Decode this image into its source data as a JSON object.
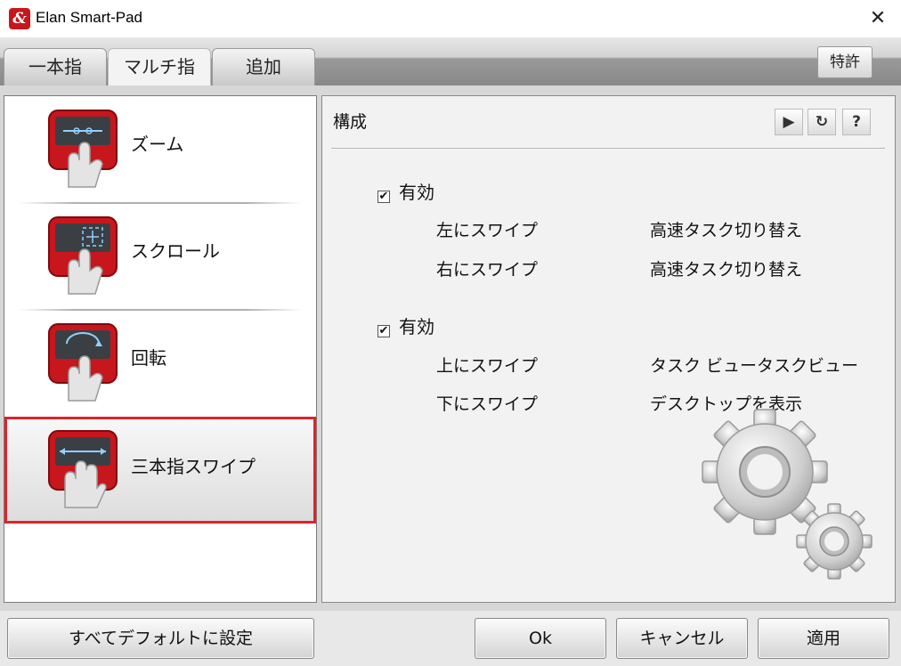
{
  "window": {
    "title": "Elan Smart-Pad",
    "app_icon": "elan-logo-icon",
    "close_glyph": "✕"
  },
  "tabs": [
    {
      "label": "一本指",
      "active": false
    },
    {
      "label": "マルチ指",
      "active": true
    },
    {
      "label": "追加",
      "active": false
    }
  ],
  "patent_button": "特許",
  "gestures": [
    {
      "label": "ズーム",
      "icon": "zoom-gesture-icon",
      "selected": false
    },
    {
      "label": "スクロール",
      "icon": "scroll-gesture-icon",
      "selected": false
    },
    {
      "label": "回転",
      "icon": "rotate-gesture-icon",
      "selected": false
    },
    {
      "label": "三本指スワイプ",
      "icon": "three-finger-swipe-icon",
      "selected": true
    }
  ],
  "config": {
    "title": "構成",
    "toolbar": {
      "play": "▶",
      "refresh": "↻",
      "help": "?"
    },
    "groups": [
      {
        "enabled_label": "有効",
        "checked": true,
        "rows": [
          {
            "action": "左にスワイプ",
            "value": "高速タスク切り替え"
          },
          {
            "action": "右にスワイプ",
            "value": "高速タスク切り替え"
          }
        ]
      },
      {
        "enabled_label": "有効",
        "checked": true,
        "rows": [
          {
            "action": "上にスワイプ",
            "value": "タスク ビュータスクビュー"
          },
          {
            "action": "下にスワイプ",
            "value": "デスクトップを表示"
          }
        ]
      }
    ],
    "checkmark": "✔"
  },
  "buttons": {
    "defaults": "すべてデフォルトに設定",
    "ok": "Ok",
    "cancel": "キャンセル",
    "apply": "適用"
  },
  "colors": {
    "accent_red": "#e0232a",
    "icon_red": "#c8161d"
  }
}
